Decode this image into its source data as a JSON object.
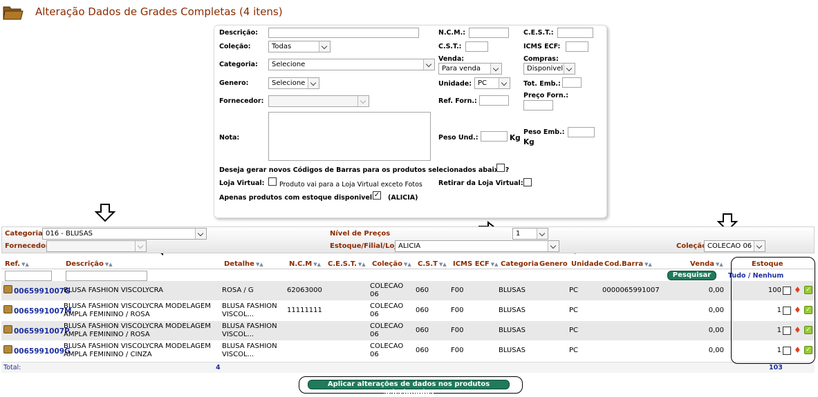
{
  "header": {
    "title": "Alteração Dados de Grades Completas (4 itens)"
  },
  "form": {
    "descricao_label": "Descrição:",
    "ncm_label": "N.C.M.:",
    "cest_label": "C.E.S.T.:",
    "colecao_label": "Coleção:",
    "colecao_value": "Todas",
    "cst_label": "C.S.T.:",
    "icms_label": "ICMS ECF:",
    "venda_label": "Venda:",
    "venda_value": "Para venda",
    "compras_label": "Compras:",
    "compras_value": "Disponivel",
    "categoria_label": "Categoria:",
    "categoria_value": "Selecione",
    "genero_label": "Genero:",
    "genero_value": "Selecione",
    "unidade_label": "Unidade:",
    "unidade_value": "PC",
    "tot_emb_label": "Tot. Emb.:",
    "preco_forn_label": "Preço Forn.:",
    "fornecedor_label": "Fornecedor:",
    "ref_forn_label": "Ref. Forn.:",
    "nota_label": "Nota:",
    "peso_und_label": "Peso Und.:",
    "peso_und_unit": "Kg",
    "peso_emb_label": "Peso Emb.:",
    "peso_emb_unit": "Kg",
    "gerar_codigos_label": "Deseja gerar novos Códigos de Barras para os produtos selecionados abaixo ?",
    "loja_virtual_label": "Loja Virtual:",
    "loja_virtual_text": "Produto vai para a Loja Virtual exceto Fotos",
    "retirar_loja_label": "Retirar da Loja Virtual:",
    "apenas_estoque_label": "Apenas produtos com estoque disponivel ?",
    "apenas_estoque_suffix": "(ALICIA)"
  },
  "filters": {
    "categorias_label": "Categorias",
    "categorias_value": "016 - BLUSAS",
    "nivel_precos_label": "Nível de Preços",
    "nivel_precos_value": "1",
    "fornecedor_label": "Fornecedor",
    "estoque_label": "Estoque/Filial/Loja",
    "estoque_value": "ALICIA",
    "colecao_label": "Coleção:",
    "colecao_value": "COLECAO 06"
  },
  "table": {
    "headers": {
      "ref": "Ref.",
      "descricao": "Descrição",
      "detalhe": "Detalhe",
      "ncm": "N.C.M",
      "cest": "C.E.S.T.",
      "colecao": "Coleção",
      "cst": "C.S.T",
      "icms": "ICMS ECF",
      "categoria": "Categoria",
      "genero": "Genero",
      "unidade": "Unidade",
      "cod_barra": "Cod.Barra",
      "venda": "Venda",
      "estoque": "Estoque"
    },
    "search_button": "Pesquisar",
    "tudo": "Tudo",
    "sep": "/",
    "nenhum": "Nenhum",
    "rows": [
      {
        "ref": "0065991007G",
        "desc1": "BLUSA FASHION VISCOLYCRA",
        "desc2": "",
        "det1": "ROSA / G",
        "det2": "",
        "ncm": "62063000",
        "col1": "COLECAO",
        "col2": "06",
        "cst": "060",
        "icms": "F00",
        "categoria": "BLUSAS",
        "unidade": "PC",
        "cod_barra": "0000065991007",
        "venda": "0,00",
        "estoque": "100"
      },
      {
        "ref": "0065991007M",
        "desc1": "BLUSA FASHION VISCOLYCRA MODELAGEM",
        "desc2": "AMPLA FEMININO / ROSA",
        "det1": "BLUSA FASHION",
        "det2": "VISCOL...",
        "ncm": "11111111",
        "col1": "COLECAO",
        "col2": "06",
        "cst": "060",
        "icms": "F00",
        "categoria": "BLUSAS",
        "unidade": "PC",
        "cod_barra": "",
        "venda": "0,00",
        "estoque": "1"
      },
      {
        "ref": "0065991007P",
        "desc1": "BLUSA FASHION VISCOLYCRA MODELAGEM",
        "desc2": "AMPLA FEMININO / ROSA",
        "det1": "BLUSA FASHION",
        "det2": "VISCOL...",
        "ncm": "",
        "col1": "COLECAO",
        "col2": "06",
        "cst": "060",
        "icms": "F00",
        "categoria": "BLUSAS",
        "unidade": "PC",
        "cod_barra": "",
        "venda": "0,00",
        "estoque": "1"
      },
      {
        "ref": "0065991009G",
        "desc1": "BLUSA FASHION VISCOLYCRA MODELAGEM",
        "desc2": "AMPLA FEMININO / CINZA",
        "det1": "BLUSA FASHION",
        "det2": "VISCOL...",
        "ncm": "",
        "col1": "COLECAO",
        "col2": "06",
        "cst": "060",
        "icms": "F00",
        "categoria": "BLUSAS",
        "unidade": "PC",
        "cod_barra": "",
        "venda": "0,00",
        "estoque": "1"
      }
    ],
    "total_label": "Total:",
    "total_count": "4",
    "total_estoque": "103"
  },
  "apply_button": "Aplicar alterações de dados nos produtos selecionados",
  "colors": {
    "accent": "#8b2b00",
    "link": "#1c2f9e",
    "button": "#207a5c"
  }
}
